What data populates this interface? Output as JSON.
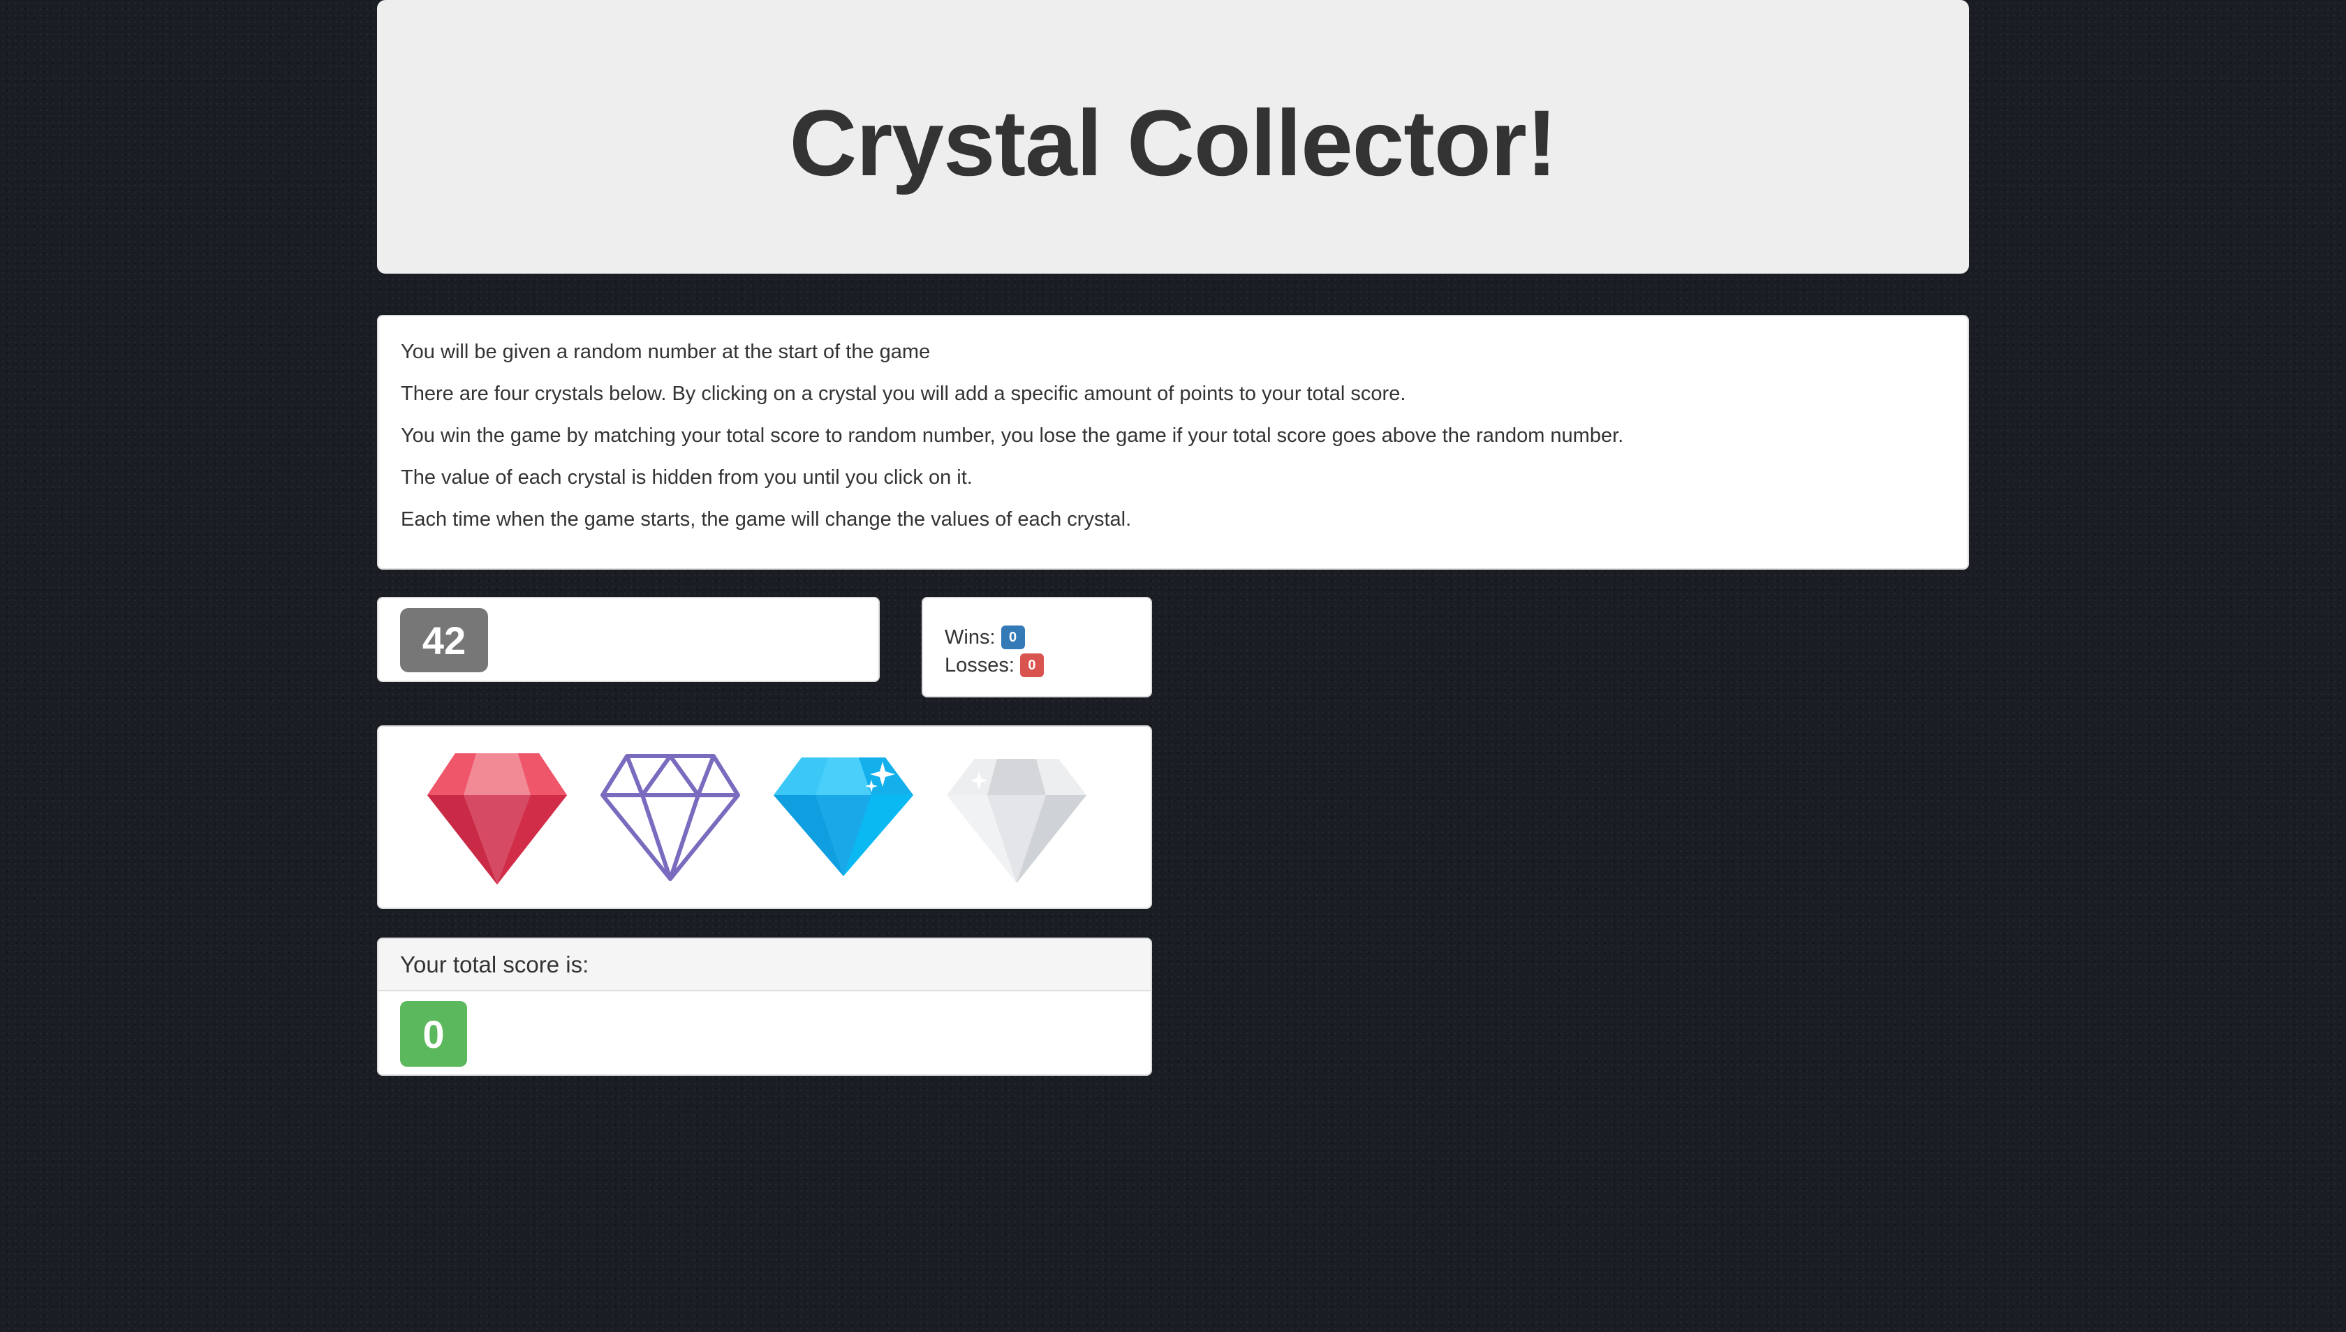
{
  "header": {
    "title": "Crystal Collector!"
  },
  "instructions": [
    "You will be given a random number at the start of the game",
    "There are four crystals below. By clicking on a crystal you will add a specific amount of points to your total score.",
    "You win the game by matching your total score to random number, you lose the game if your total score goes above the random number.",
    "The value of each crystal is hidden from you until you click on it.",
    "Each time when the game starts, the game will change the values of each crystal."
  ],
  "target": {
    "number": "42"
  },
  "record": {
    "wins_label": "Wins:",
    "wins_value": "0",
    "losses_label": "Losses:",
    "losses_value": "0"
  },
  "crystals": [
    {
      "icon": "red-ruby-icon",
      "color": "#e0344f"
    },
    {
      "icon": "purple-outline-diamond-icon",
      "color": "#7b6bbf"
    },
    {
      "icon": "blue-diamond-icon",
      "color": "#1bb6f2"
    },
    {
      "icon": "white-diamond-icon",
      "color": "#e1e4e8"
    }
  ],
  "score": {
    "heading": "Your total score is:",
    "value": "0"
  },
  "colors": {
    "background": "#1a1e24",
    "target_badge": "#777777",
    "wins_badge": "#337ab7",
    "losses_badge": "#d9534f",
    "score_badge": "#5cb85c"
  }
}
